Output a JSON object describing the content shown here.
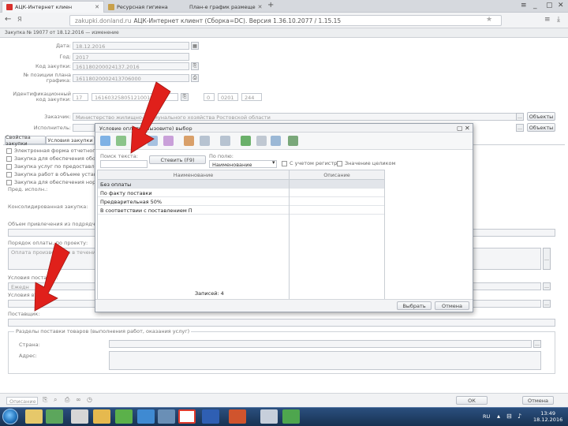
{
  "browser": {
    "tabs": [
      {
        "label": "АЦК-Интернет клиен"
      },
      {
        "label": "Ресурсная гигиена"
      },
      {
        "label": "План-е график размеще"
      }
    ],
    "back_label": "Я",
    "address_host": "zakupki.donland.ru",
    "address_title": "АЦК-Интернет клиент (Сборка=DC). Версия 1.36.10.2077 / 1.15.15"
  },
  "app": {
    "header": "Закупка № 19077 от 18.12.2016 — изменение"
  },
  "form": {
    "date_label": "Дата:",
    "date_value": "18.12.2016",
    "year_label": "Год:",
    "year_value": "2017",
    "code_label": "Код закупки:",
    "code_value": "161180200024137.2016",
    "plan_pos_label": "№ позиции плана графика:",
    "plan_pos_value": "16118020002413706000",
    "ident_label": "Идентификационный код закупки:",
    "ident_parts": [
      "17",
      "1616032580512100100",
      "0",
      "0201",
      "244"
    ],
    "customer_label": "Заказчик:",
    "customer_value": "Министерство жилищно-коммунального хозяйства Ростовской области",
    "customer_btn": "Объекты",
    "contractor_label": "Исполнитель:",
    "contractor_btn": "Объекты",
    "tabs": [
      "Свойства закупки",
      "Условия закупки"
    ],
    "checkboxes": [
      "Электронная форма отчетного к",
      "Закупка для обеспечения обор",
      "Закупка услуг по предоставле",
      "Закупка работ в объеме устан",
      "Закупка для обеспечения норм"
    ],
    "prev_exec_label": "Пред. исполн.:",
    "consolidated_label": "Консолидированная закупка:",
    "advance_label": "Объем привлечения из подрядчиков С",
    "payment_label": "Порядок оплаты, по проекту:",
    "payment_value": "Оплата производится в течение 3",
    "conditions_label": "Условия поставки:",
    "delivery_value": "Ежедн",
    "other_label": "Условия вт.",
    "comment_label": "Поставщик:",
    "section_title": "Разделы поставки товаров (выполнения работ, оказания услуг)",
    "country_label": "Страна:",
    "address_label": "Адрес:",
    "bottom_select": "Описание",
    "ok_btn": "ОК",
    "close_btn": "Отмена"
  },
  "modal": {
    "title": "Условие оплаты (вызовите) выбор",
    "search_label": "Поиск текста:",
    "search_btn": "Стевить (F9)",
    "field_label": "По полю:",
    "field_value": "Наименование",
    "case_label": "С учетом регистра",
    "whole_label": "Значение целиком",
    "col_name": "Наименование",
    "col_desc": "Описание",
    "rows": [
      "Без оплаты",
      "По факту поставки",
      "Предварительная 50%",
      "В соответствии с поставлением П"
    ],
    "records": "Записей: 4",
    "select_btn": "Выбрать",
    "cancel_btn": "Отмена"
  },
  "taskbar": {
    "time": "13:49",
    "date": "18.12.2016",
    "lang": "RU"
  },
  "colors": {
    "arrow": "#e0201b",
    "taskbar": "#1f3d66"
  }
}
